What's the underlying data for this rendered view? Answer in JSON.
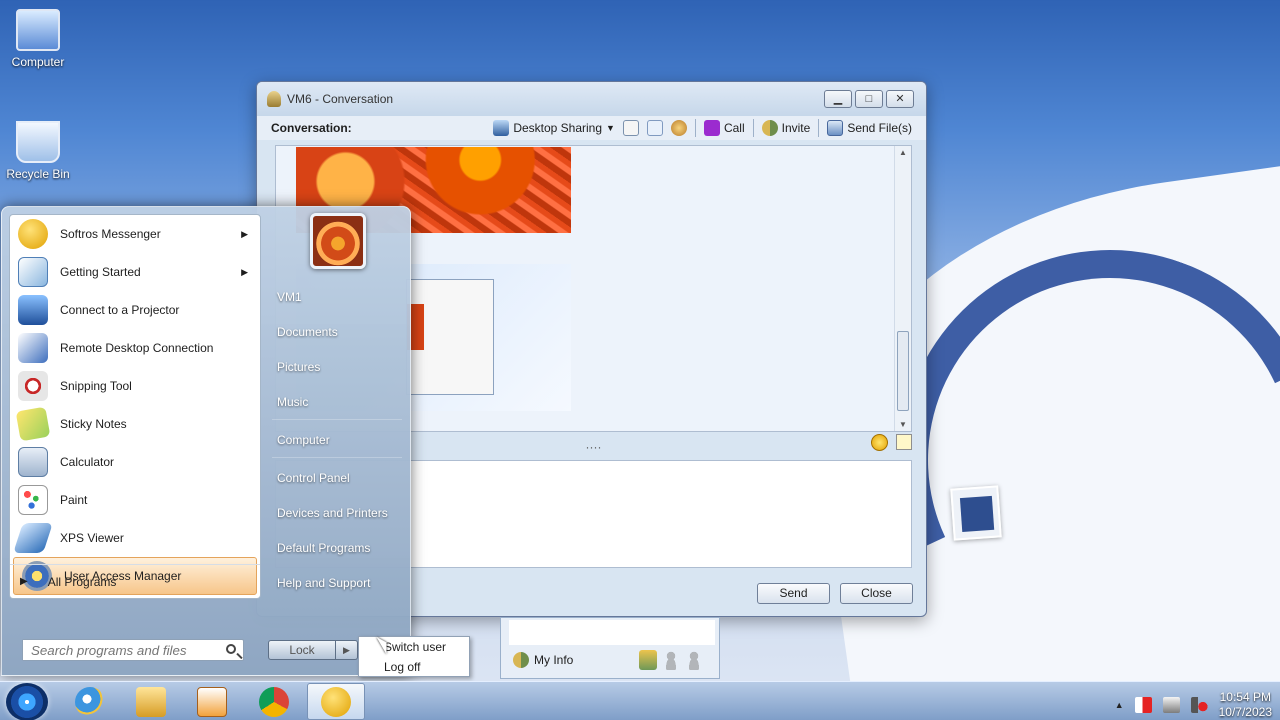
{
  "desktop": {
    "icons": [
      {
        "label": "Computer",
        "icon": "computer-icon"
      },
      {
        "label": "Recycle Bin",
        "icon": "recycle-bin-icon"
      }
    ]
  },
  "conversation_window": {
    "title": "VM6 - Conversation",
    "controls": [
      "▁",
      "□",
      "✕"
    ],
    "conversation_label": "Conversation:",
    "toolbar": {
      "desktop_sharing": "Desktop Sharing",
      "call": "Call",
      "invite": "Invite",
      "send_files": "Send File(s)"
    },
    "splitter_handle": "····",
    "buttons": {
      "send": "Send",
      "close": "Close"
    }
  },
  "contact_panel": {
    "my_info": "My Info"
  },
  "start_menu": {
    "pinned": [
      {
        "label": "Softros Messenger",
        "icon": "softros-messenger-icon",
        "submenu_arrow": "▶"
      },
      {
        "label": "Getting Started",
        "icon": "getting-started-icon",
        "submenu_arrow": "▶"
      },
      {
        "label": "Connect to a Projector",
        "icon": "projector-icon"
      },
      {
        "label": "Remote Desktop Connection",
        "icon": "remote-desktop-icon"
      },
      {
        "label": "Snipping Tool",
        "icon": "snipping-tool-icon"
      },
      {
        "label": "Sticky Notes",
        "icon": "sticky-notes-icon"
      },
      {
        "label": "Calculator",
        "icon": "calculator-icon"
      },
      {
        "label": "Paint",
        "icon": "paint-icon"
      },
      {
        "label": "XPS Viewer",
        "icon": "xps-viewer-icon"
      },
      {
        "label": "User Access Manager",
        "icon": "user-access-manager-icon"
      }
    ],
    "all_programs": "All Programs",
    "all_programs_arrow": "▶",
    "search_placeholder": "Search programs and files",
    "places": [
      "VM1",
      "Documents",
      "Pictures",
      "Music",
      "Computer",
      "Control Panel",
      "Devices and Printers",
      "Default Programs",
      "Help and Support"
    ],
    "lock_label": "Lock",
    "lock_arrow": "▶",
    "power_menu": [
      "Switch user",
      "Log off"
    ]
  },
  "taskbar": {
    "tray_arrow": "▲",
    "time": "10:54 PM",
    "date": "10/7/2023"
  },
  "colors": {
    "accent": "#f7c68a",
    "window_border": "#65779a",
    "taskbar": "#7f9ec8"
  }
}
